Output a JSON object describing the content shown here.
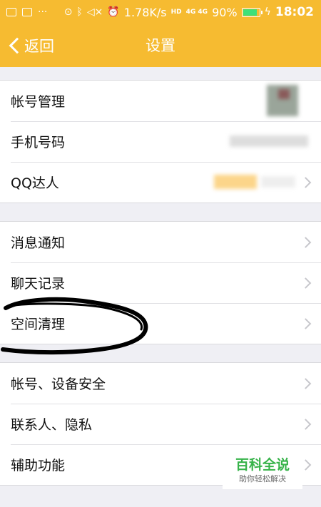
{
  "status_bar": {
    "speed": "1.78K/s",
    "network_type": "HD",
    "signal_small_top": "4G 4G",
    "battery_percent": "90%",
    "battery_level": 0.9,
    "time": "18:02",
    "icons": [
      "image-icon",
      "message-icon",
      "more-icon",
      "location-icon",
      "bluetooth-icon",
      "mute-icon",
      "alarm-icon",
      "signal-icon",
      "battery-icon",
      "charging-icon"
    ]
  },
  "header": {
    "back_label": "返回",
    "title": "设置"
  },
  "groups": [
    {
      "items": [
        {
          "label": "帐号管理"
        },
        {
          "label": "手机号码"
        },
        {
          "label": "QQ达人"
        }
      ]
    },
    {
      "items": [
        {
          "label": "消息通知"
        },
        {
          "label": "聊天记录"
        },
        {
          "label": "空间清理"
        }
      ]
    },
    {
      "items": [
        {
          "label": "帐号、设备安全"
        },
        {
          "label": "联系人、隐私"
        },
        {
          "label": "辅助功能"
        }
      ]
    }
  ],
  "watermark": {
    "main": "百科全说",
    "sub": "助你轻松解决"
  },
  "colors": {
    "accent": "#f6bb31",
    "background": "#efeff4",
    "watermark_green": "#37b34a",
    "scribble": "#000000"
  }
}
